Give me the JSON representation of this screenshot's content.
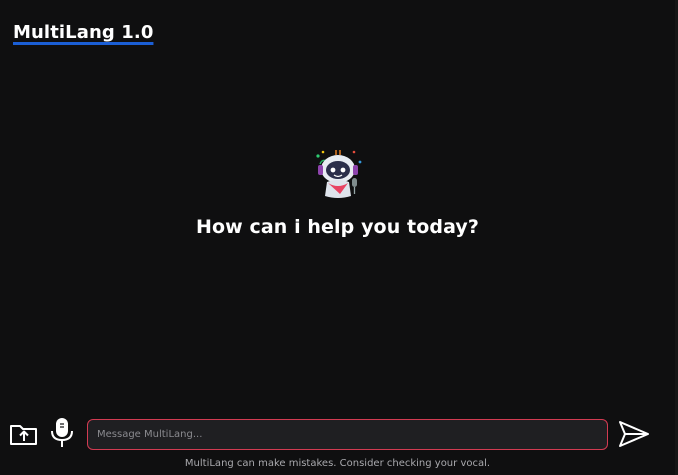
{
  "app": {
    "brand": "MultiLang 1.0"
  },
  "main": {
    "prompt": "How can i help you today?",
    "avatar_icon": "robot-mascot-icon"
  },
  "composer": {
    "upload_icon": "folder-upload-icon",
    "mic_icon": "microphone-icon",
    "input_value": "",
    "input_placeholder": "Message MultiLang...",
    "send_icon": "send-icon"
  },
  "footer": {
    "disclaimer": "MultiLang can make mistakes. Consider checking your vocal."
  },
  "colors": {
    "background": "#0f0f10",
    "input_border": "#d23b52",
    "brand_underline": "#1b5fd6"
  }
}
